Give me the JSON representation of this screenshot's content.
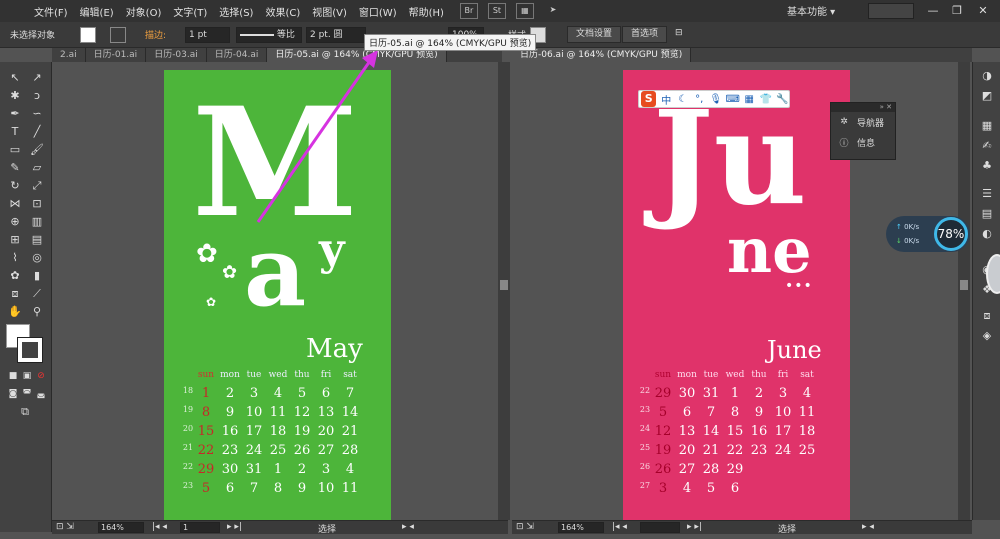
{
  "menubar": {
    "items": [
      "文件(F)",
      "编辑(E)",
      "对象(O)",
      "文字(T)",
      "选择(S)",
      "效果(C)",
      "视图(V)",
      "窗口(W)",
      "帮助(H)"
    ],
    "icons": [
      "Br",
      "St"
    ],
    "workspace": "基本功能"
  },
  "controlbar": {
    "selection": "未选择对象",
    "stroke_label": "描边:",
    "stroke_value": "1 pt",
    "profile": "等比",
    "brush": "2 pt. 圆",
    "opacity_value": "100%",
    "style_label": "样式",
    "doc_settings": "文档设置",
    "preferences": "首选项"
  },
  "tooltip": "日历-05.ai @ 164% (CMYK/GPU 预览)",
  "tabs_left": [
    {
      "label": "2.ai",
      "active": false
    },
    {
      "label": "日历-01.ai",
      "active": false
    },
    {
      "label": "日历-03.ai",
      "active": false
    },
    {
      "label": "日历-04.ai",
      "active": false
    },
    {
      "label": "日历-05.ai @ 164% (CMYK/GPU 预览)",
      "active": true
    }
  ],
  "tabs_right": [
    {
      "label": "日历-06.ai @ 164% (CMYK/GPU 预览)",
      "active": true
    }
  ],
  "may": {
    "big_m": "M",
    "big_a": "a",
    "big_y": "y",
    "title": "May",
    "color": "#4db53a",
    "headers": [
      "sun",
      "mon",
      "tue",
      "wed",
      "thu",
      "fri",
      "sat"
    ],
    "weeks": [
      {
        "wk": "18",
        "days": [
          "",
          "1",
          "2",
          "3",
          "4",
          "5",
          "6",
          "7"
        ]
      },
      {
        "wk": "19",
        "days": [
          "",
          "8",
          "9",
          "10",
          "11",
          "12",
          "13",
          "14"
        ]
      },
      {
        "wk": "20",
        "days": [
          "",
          "15",
          "16",
          "17",
          "18",
          "19",
          "20",
          "21"
        ]
      },
      {
        "wk": "21",
        "days": [
          "",
          "22",
          "23",
          "24",
          "25",
          "26",
          "27",
          "28"
        ]
      },
      {
        "wk": "22",
        "days": [
          "",
          "29",
          "30",
          "31",
          "1",
          "2",
          "3",
          "4"
        ]
      },
      {
        "wk": "23",
        "days": [
          "",
          "5",
          "6",
          "7",
          "8",
          "9",
          "10",
          "11"
        ]
      }
    ]
  },
  "june": {
    "big_ju": "Ju",
    "big_ne": "ne",
    "dots": "•••",
    "title": "June",
    "color": "#e0336a",
    "headers": [
      "sun",
      "mon",
      "tue",
      "wed",
      "thu",
      "fri",
      "sat"
    ],
    "weeks": [
      {
        "wk": "22",
        "days": [
          "",
          "29",
          "30",
          "31",
          "1",
          "2",
          "3",
          "4"
        ]
      },
      {
        "wk": "23",
        "days": [
          "",
          "5",
          "6",
          "7",
          "8",
          "9",
          "10",
          "11"
        ]
      },
      {
        "wk": "24",
        "days": [
          "",
          "12",
          "13",
          "14",
          "15",
          "16",
          "17",
          "18"
        ]
      },
      {
        "wk": "25",
        "days": [
          "",
          "19",
          "20",
          "21",
          "22",
          "23",
          "24",
          "25"
        ]
      },
      {
        "wk": "26",
        "days": [
          "",
          "26",
          "27",
          "28",
          "29",
          "",
          "",
          ""
        ]
      },
      {
        "wk": "27",
        "days": [
          "",
          "3",
          "4",
          "5",
          "6",
          "",
          "",
          ""
        ]
      }
    ]
  },
  "navpanel": {
    "items": [
      "导航器",
      "信息"
    ]
  },
  "ime": {
    "logo": "S",
    "lang": "中"
  },
  "speedmeter": {
    "up": "0K/s",
    "down": "0K/s",
    "percent": "78%"
  },
  "status_left": {
    "zoom": "164%",
    "page": "1",
    "mode": "选择"
  },
  "status_right": {
    "zoom": "164%",
    "page": "",
    "mode": "选择"
  }
}
